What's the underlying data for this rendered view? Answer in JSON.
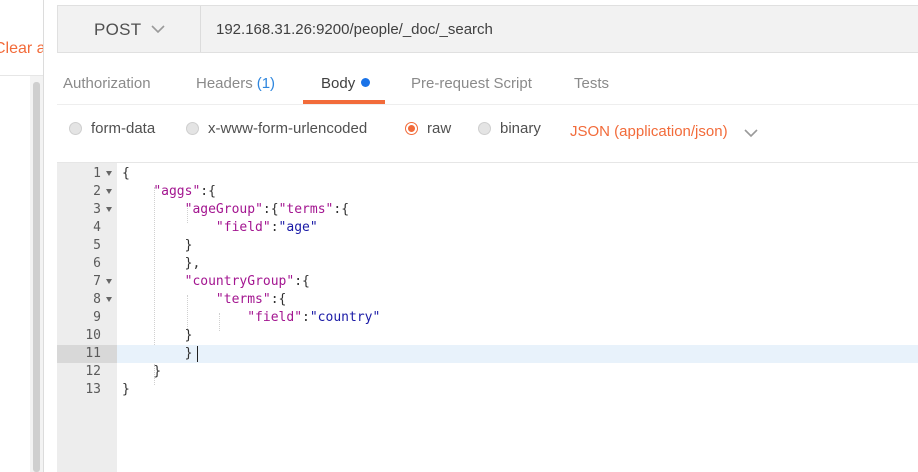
{
  "sidebar": {
    "clear_all_label": "Clear all"
  },
  "request": {
    "method": "POST",
    "url": "192.168.31.26:9200/people/_doc/_search"
  },
  "tabs": [
    {
      "label": "Authorization"
    },
    {
      "label": "Headers",
      "count": "(1)"
    },
    {
      "label": "Body",
      "active": true,
      "indicator": "blue-dot"
    },
    {
      "label": "Pre-request Script"
    },
    {
      "label": "Tests"
    }
  ],
  "body_types": {
    "options": [
      "form-data",
      "x-www-form-urlencoded",
      "raw",
      "binary"
    ],
    "selected": "raw",
    "content_type": "JSON (application/json)"
  },
  "editor": {
    "active_line": 11,
    "lines": [
      {
        "n": "1",
        "text": "{"
      },
      {
        "n": "2",
        "text": "    \"aggs\":{"
      },
      {
        "n": "3",
        "text": "        \"ageGroup\":{\"terms\":{"
      },
      {
        "n": "4",
        "text": "            \"field\":\"age\""
      },
      {
        "n": "5",
        "text": "        }"
      },
      {
        "n": "6",
        "text": "        },"
      },
      {
        "n": "7",
        "text": "        \"countryGroup\":{"
      },
      {
        "n": "8",
        "text": "            \"terms\":{"
      },
      {
        "n": "9",
        "text": "                \"field\":\"country\""
      },
      {
        "n": "10",
        "text": "        }"
      },
      {
        "n": "11",
        "text": "        }"
      },
      {
        "n": "12",
        "text": "    }"
      },
      {
        "n": "13",
        "text": "}"
      }
    ]
  },
  "colors": {
    "accent": "#f26b3a",
    "active_dot": "#1a73e8",
    "json_key": "#a31590",
    "json_string": "#1a1aa6"
  }
}
